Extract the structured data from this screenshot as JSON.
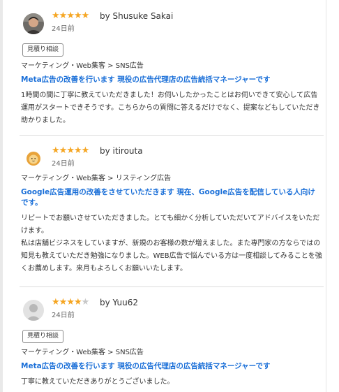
{
  "reviews": [
    {
      "stars_filled": 5,
      "stars_total": 5,
      "reviewer": "by Shusuke Sakai",
      "date": "24日前",
      "tag": "見積り相談",
      "category": "マーケティング・Web集客 > SNS広告",
      "title": "Meta広告の改善を行います 現役の広告代理店の広告統括マネージャーです",
      "body": [
        "1時間の間に丁寧に教えていただきました！お伺いしたかったことはお伺いできて安心して広告運用がスタートできそうです。こちらからの質問に答えるだけでなく、提案などもしていただき助かりました。"
      ]
    },
    {
      "stars_filled": 5,
      "stars_total": 5,
      "reviewer": "by itirouta",
      "date": "24日前",
      "category": "マーケティング・Web集客 > リスティング広告",
      "title": "Google広告運用の改善をさせていただきます 現在、Google広告を配信している人向けです。",
      "body": [
        "リピートでお願いさせていただきました。とても細かく分析していただいてアドバイスをいただけます。",
        "私は店舗ビジネスをしていますが、新規のお客様の数が増えました。また専門家の方ならではの知見も教えていただき勉強になりました。WEB広告で悩んでいる方は一度相談してみることを強くお薦めします。来月もよろしくお願いいたします。"
      ]
    },
    {
      "stars_filled": 4,
      "stars_total": 5,
      "reviewer": "by Yuu62",
      "date": "24日前",
      "tag": "見積り相談",
      "category": "マーケティング・Web集客 > SNS広告",
      "title": "Meta広告の改善を行います 現役の広告代理店の広告統括マネージャーです",
      "body": [
        "丁寧に教えていただきありがとうございました。"
      ]
    }
  ],
  "colors": {
    "star_on": "#f5a623",
    "star_off": "#c8c8c8",
    "title_link": "#1a6fd8"
  },
  "icons": {
    "star": "star-icon",
    "avatar_1": "user-photo-avatar",
    "avatar_2": "lion-avatar",
    "avatar_3": "default-user-avatar"
  }
}
